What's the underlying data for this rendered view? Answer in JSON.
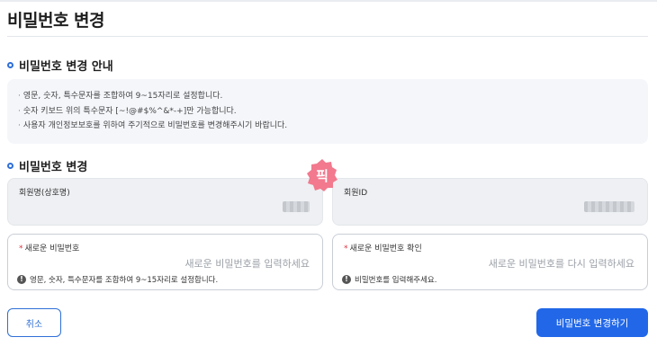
{
  "page": {
    "title": "비밀번호 변경"
  },
  "guide": {
    "heading": "비밀번호 변경 안내",
    "lines": [
      "영문, 숫자, 특수문자를 조합하여 9~15자리로 설정합니다.",
      "숫자 키보드 위의 특수문자 [~!@#$%^&*-+]만 가능합니다.",
      "사용자 개인정보보호를 위하여 주기적으로 비밀번호를 변경해주시기 바랍니다."
    ]
  },
  "form": {
    "heading": "비밀번호 변경",
    "member_name": {
      "label": "회원명(상호명)"
    },
    "member_id": {
      "label": "회원ID"
    },
    "new_password": {
      "label": "새로운 비밀번호",
      "placeholder": "새로운 비밀번호를 입력하세요",
      "hint": "영문, 숫자, 특수문자를 조합하여 9~15자리로 설정합니다."
    },
    "confirm_password": {
      "label": "새로운 비밀번호 확인",
      "placeholder": "새로운 비밀번호를 다시 입력하세요",
      "hint": "비밀번호를 입력해주세요."
    }
  },
  "watermark": {
    "text": "픽"
  },
  "actions": {
    "cancel_label": "취소",
    "submit_label": "비밀번호 변경하기"
  },
  "colors": {
    "accent": "#2167e8",
    "required": "#e0313b",
    "watermark": "#f2798e"
  },
  "icons": {
    "section": "circle-bullet-icon",
    "hint": "exclamation-circle-icon"
  }
}
